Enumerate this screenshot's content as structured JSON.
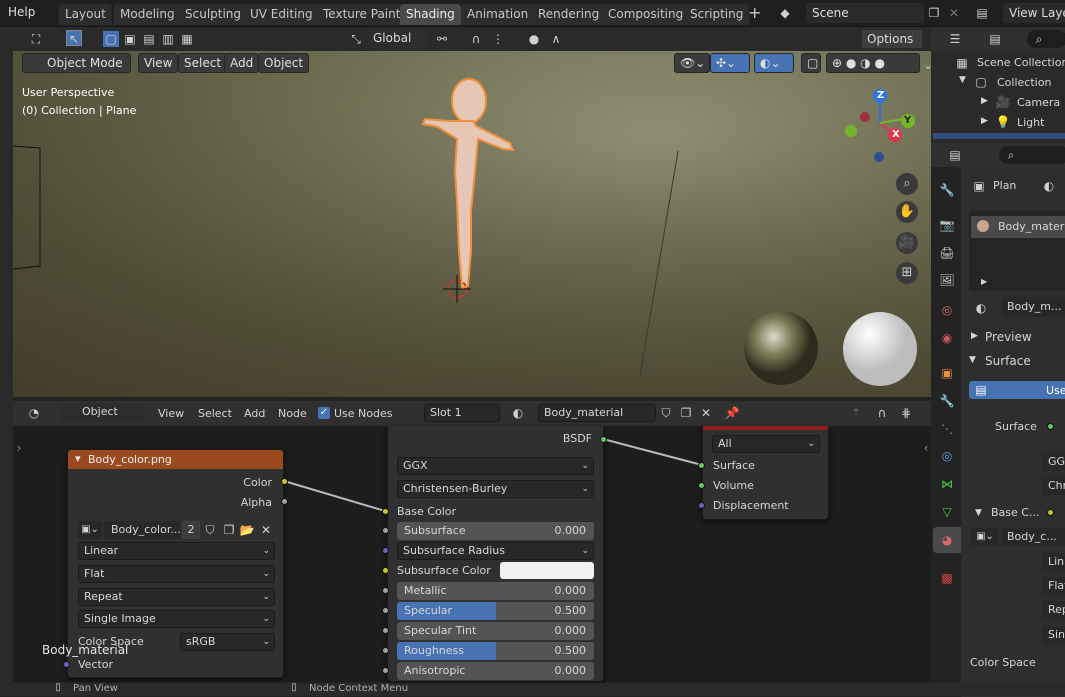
{
  "menu": {
    "help": "Help"
  },
  "workspaces": [
    "Layout",
    "Modeling",
    "Sculpting",
    "UV Editing",
    "Texture Paint",
    "Shading",
    "Animation",
    "Rendering",
    "Compositing",
    "Scripting"
  ],
  "active_workspace": "Shading",
  "add_workspace": "+",
  "scene": {
    "name": "Scene",
    "view_layer": "View Layer"
  },
  "toolbar3d": {
    "orientation": "Global",
    "options": "Options"
  },
  "viewport": {
    "mode": "Object Mode",
    "menus": [
      "View",
      "Select",
      "Add",
      "Object"
    ],
    "info_line1": "User Perspective",
    "info_line2": "(0) Collection | Plane",
    "gizmo": {
      "x": "X",
      "y": "Y",
      "z": "Z"
    }
  },
  "node_editor": {
    "type": "Object",
    "menus": [
      "View",
      "Select",
      "Add",
      "Node"
    ],
    "use_nodes": "Use Nodes",
    "slot": "Slot 1",
    "material": "Body_material",
    "frame_label": "Body_material"
  },
  "image_node": {
    "title": "Body_color.png",
    "out_color": "Color",
    "out_alpha": "Alpha",
    "image_name": "Body_color....",
    "users": "2",
    "interpolation": "Linear",
    "projection": "Flat",
    "extension": "Repeat",
    "source": "Single Image",
    "color_space_label": "Color Space",
    "color_space": "sRGB",
    "in_vector": "Vector"
  },
  "bsdf_node": {
    "out": "BSDF",
    "distribution": "GGX",
    "subsurface_method": "Christensen-Burley",
    "base_color": "Base Color",
    "rows": [
      {
        "label": "Subsurface",
        "value": "0.000",
        "fill": 0
      },
      {
        "label": "Subsurface Radius",
        "value": "",
        "dropdown": true
      },
      {
        "label": "Subsurface Color",
        "value": "",
        "color": true
      },
      {
        "label": "Metallic",
        "value": "0.000",
        "fill": 0
      },
      {
        "label": "Specular",
        "value": "0.500",
        "fill": 0.5
      },
      {
        "label": "Specular Tint",
        "value": "0.000",
        "fill": 0
      },
      {
        "label": "Roughness",
        "value": "0.500",
        "fill": 0.5
      },
      {
        "label": "Anisotropic",
        "value": "0.000",
        "fill": 0
      }
    ]
  },
  "output_node": {
    "target": "All",
    "inputs": [
      "Surface",
      "Volume",
      "Displacement"
    ]
  },
  "outliner": {
    "scene_collection": "Scene Collection",
    "collection": "Collection",
    "camera": "Camera",
    "light": "Light"
  },
  "properties": {
    "object": "Plan",
    "material_slot": "Body_materia",
    "material_field": "Body_m...",
    "preview": "Preview",
    "surface": "Surface",
    "use_btn": "Use",
    "surface_label": "Surface",
    "ggx": "GG",
    "chr": "Chr",
    "base_color": "Base C...",
    "image": "Body_c...",
    "lin": "Lin",
    "flat": "Flat",
    "rep": "Rep",
    "sin": "Sin",
    "color_space": "Color Space"
  },
  "status": {
    "left": "Pan View",
    "right": "Node Context Menu"
  },
  "colors": {
    "accent": "#4772b3",
    "selection": "#e8903a",
    "node_header_image": "#9a4a1e",
    "active_tab": "#4a4a4a",
    "x_axis": "#e0364b",
    "y_axis": "#74b62a",
    "z_axis": "#2f75de"
  }
}
